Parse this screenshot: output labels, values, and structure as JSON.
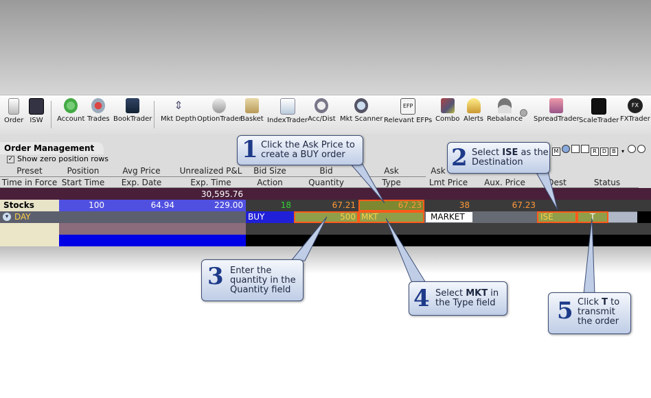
{
  "toolbar": {
    "items": [
      {
        "label": "Order",
        "icon": "order-icon"
      },
      {
        "label": "ISW",
        "icon": "isw-icon"
      },
      {
        "label": "Account",
        "icon": "account-icon"
      },
      {
        "label": "Trades",
        "icon": "trades-icon"
      },
      {
        "label": "BookTrader",
        "icon": "booktrader-icon"
      },
      {
        "label": "Mkt Depth",
        "icon": "mkt-depth-icon"
      },
      {
        "label": "OptionTrader",
        "icon": "optiontrader-icon"
      },
      {
        "label": "Basket",
        "icon": "basket-icon"
      },
      {
        "label": "IndexTrader",
        "icon": "indextrader-icon"
      },
      {
        "label": "Acc/Dist",
        "icon": "acc-dist-icon"
      },
      {
        "label": "Mkt Scanner",
        "icon": "mkt-scanner-icon"
      },
      {
        "label": "Relevant EFPs",
        "icon": "relevant-efps-icon"
      },
      {
        "label": "Combo",
        "icon": "combo-icon"
      },
      {
        "label": "Alerts",
        "icon": "alerts-icon"
      },
      {
        "label": "Rebalance",
        "icon": "rebalance-icon"
      },
      {
        "label": "SpreadTrader",
        "icon": "spreadtrader-icon"
      },
      {
        "label": "ScaleTrader",
        "icon": "scaletrader-icon"
      },
      {
        "label": "FXTrader",
        "icon": "fxtrader-icon"
      }
    ],
    "efp_badge": "EFP",
    "fx_badge": "FX"
  },
  "panel": {
    "title": "Order Management",
    "show_zero_label": "Show zero position rows",
    "show_zero_checked": "✓",
    "icon_letters": [
      "M",
      "R",
      "D",
      "B"
    ]
  },
  "headers": {
    "row1": [
      "Preset",
      "Position",
      "Avg Price",
      "Unrealized P&L",
      "Bid Size",
      "Bid",
      "Ask",
      "Ask"
    ],
    "row2": [
      "Time in Force",
      "Start Time",
      "Exp. Date",
      "Exp. Time",
      "Action",
      "Quantity",
      "Type",
      "Lmt Price",
      "Aux. Price",
      "Dest",
      "Status"
    ]
  },
  "totals": {
    "unrealized": "30,595.76"
  },
  "stock_row": {
    "label": "Stocks",
    "position": "100",
    "avg_price": "64.94",
    "unrealized": "229.00",
    "bid_size": "18",
    "bid": "67.21",
    "ask": "67.23",
    "ask_size": "38",
    "last": "67.23"
  },
  "order_row": {
    "tif": "DAY",
    "action": "BUY",
    "quantity": "500",
    "type": "MKT",
    "lmt_price": "MARKET",
    "dest": "ISE",
    "status": "T"
  },
  "callouts": [
    {
      "num": "1",
      "lines": [
        "Click the Ask Price to",
        "create a BUY order"
      ]
    },
    {
      "num": "2",
      "lines": [
        "Select ISE as the",
        "Destination"
      ],
      "bold": "ISE"
    },
    {
      "num": "3",
      "lines": [
        "Enter the",
        "quantity in the",
        "Quantity field"
      ]
    },
    {
      "num": "4",
      "lines": [
        "Select MKT in",
        "the Type field"
      ],
      "bold": "MKT"
    },
    {
      "num": "5",
      "lines": [
        "Click T to",
        "transmit",
        "the order"
      ],
      "bold": "T"
    }
  ],
  "colors": {
    "highlight_border": "#ff5a1a",
    "callout_number": "#1e3b8a",
    "row_blue": "#4a4ae8",
    "bid_green": "#36d236",
    "price_orange": "#ff9a3a"
  }
}
